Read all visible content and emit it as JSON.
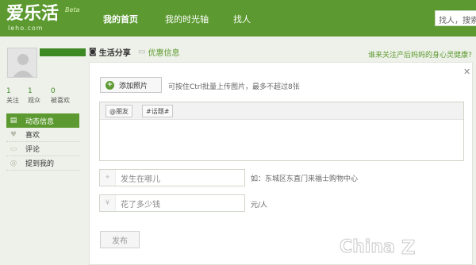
{
  "header": {
    "logo": "爱乐活",
    "logo_sub": "leho.com",
    "beta": "Beta",
    "nav": [
      "我的首页",
      "我的时光轴",
      "找人"
    ],
    "search_placeholder": "找人，搜索"
  },
  "profile": {
    "stats": [
      {
        "num": "1",
        "label": "关注"
      },
      {
        "num": "1",
        "label": "观众"
      },
      {
        "num": "0",
        "label": "被喜欢"
      }
    ]
  },
  "menu": [
    {
      "label": "动态信息",
      "icon": "feed-icon"
    },
    {
      "label": "喜欢",
      "icon": "heart-icon"
    },
    {
      "label": "评论",
      "icon": "comment-icon"
    },
    {
      "label": "提到我的",
      "icon": "at-icon"
    }
  ],
  "tabs": [
    "生活分享",
    "优惠信息"
  ],
  "top_link": "谁来关注产后妈妈的身心灵健康?",
  "composer": {
    "add_photo": "添加照片",
    "hint": "可按住Ctrl批量上传图片，最多不超过8张",
    "tag_friend": "@朋友",
    "tag_topic": "#话题#",
    "location_placeholder": "发生在哪儿",
    "location_note": "如：东城区东直门来福士购物中心",
    "cost_placeholder": "花了多少钱",
    "cost_note": "元/人",
    "publish": "发布"
  },
  "watermark": "China",
  "colors": {
    "brand": "#5c9a31",
    "accent_dark": "#3d8a25"
  }
}
